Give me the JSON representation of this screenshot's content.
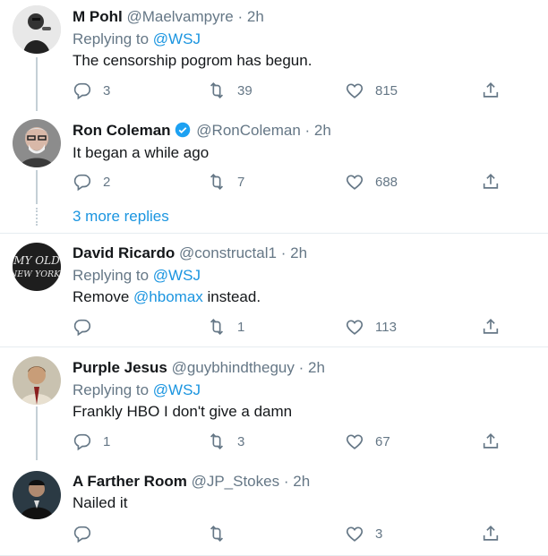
{
  "tweets": [
    {
      "name": "M Pohl",
      "handle": "@Maelvampyre",
      "time": "2h",
      "replying_prefix": "Replying to",
      "replying_to": "@WSJ",
      "text": "The censorship pogrom has begun.",
      "replies": "3",
      "retweets": "39",
      "likes": "815"
    },
    {
      "name": "Ron Coleman",
      "verified": true,
      "handle": "@RonColeman",
      "time": "2h",
      "text": "It began a while ago",
      "replies": "2",
      "retweets": "7",
      "likes": "688"
    },
    {
      "name": "David Ricardo",
      "handle": "@constructal1",
      "time": "2h",
      "replying_prefix": "Replying to",
      "replying_to": "@WSJ",
      "text_before": "Remove ",
      "text_mention": "@hbomax",
      "text_after": " instead.",
      "avatar_text": "MY OLD NEW YORK!",
      "replies": "",
      "retweets": "1",
      "likes": "113"
    },
    {
      "name": "Purple Jesus",
      "handle": "@guybhindtheguy",
      "time": "2h",
      "replying_prefix": "Replying to",
      "replying_to": "@WSJ",
      "text": "Frankly HBO I don't give a damn",
      "replies": "1",
      "retweets": "3",
      "likes": "67"
    },
    {
      "name": "A Farther Room",
      "handle": "@JP_Stokes",
      "time": "2h",
      "text": "Nailed it",
      "replies": "",
      "retweets": "",
      "likes": "3"
    }
  ],
  "separator": "·",
  "more_replies": "3 more replies",
  "colors": {
    "accent": "#1b95e0",
    "muted": "#657786",
    "text": "#14171a",
    "verified": "#1da1f2"
  },
  "icons": [
    "reply-icon",
    "retweet-icon",
    "like-icon",
    "share-icon",
    "verified-badge-icon"
  ]
}
